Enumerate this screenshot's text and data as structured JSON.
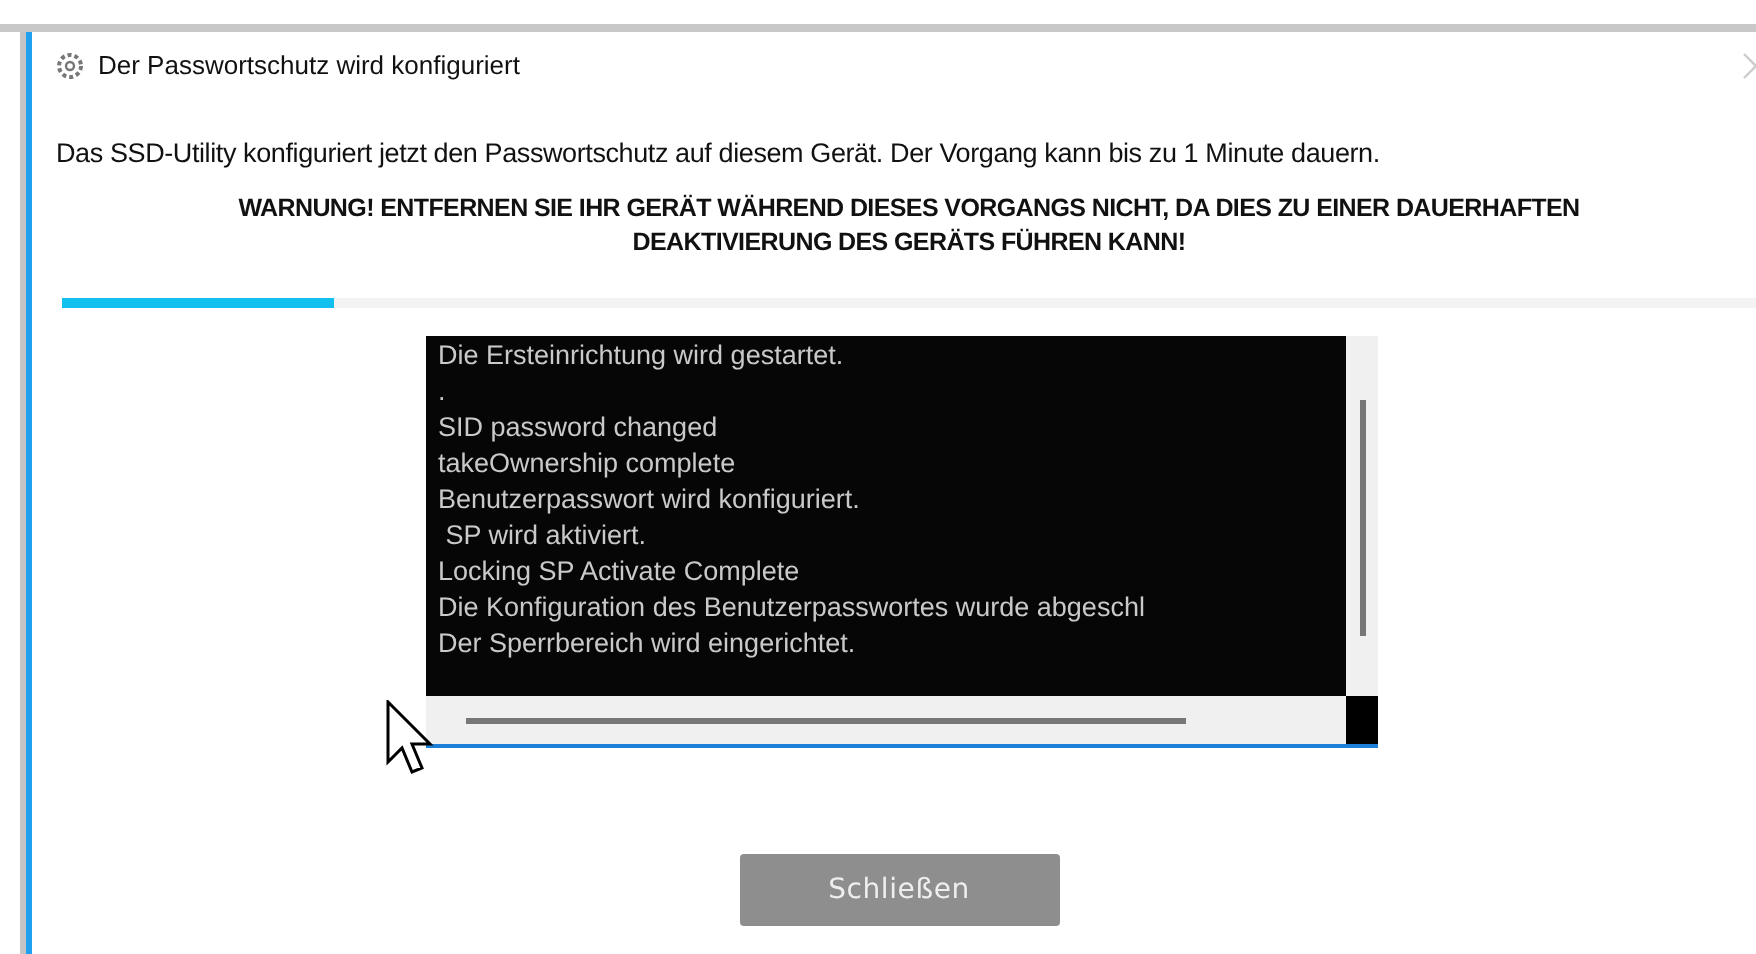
{
  "window": {
    "title": "Der Passwortschutz wird konfiguriert"
  },
  "message": "Das SSD-Utility konfiguriert jetzt den Passwortschutz auf diesem Gerät. Der Vorgang kann bis zu 1 Minute dauern.",
  "warning": "WARNUNG! ENTFERNEN SIE IHR GERÄT WÄHREND DIESES VORGANGS NICHT, DA DIES ZU EINER DAUERHAFTEN DEAKTIVIERUNG DES GERÄTS FÜHREN KANN!",
  "progress": {
    "level": 0.16
  },
  "log": {
    "lines": [
      "Die Ersteinrichtung wird gestartet.",
      ".",
      "SID password changed",
      "takeOwnership complete",
      "Benutzerpasswort wird konfiguriert.",
      " SP wird aktiviert.",
      "Locking SP Activate Complete",
      "Die Konfiguration des Benutzerpasswortes wurde abgeschl",
      "Der Sperrbereich wird eingerichtet."
    ]
  },
  "buttons": [
    {
      "label": "Schließen",
      "disabled": true
    }
  ]
}
